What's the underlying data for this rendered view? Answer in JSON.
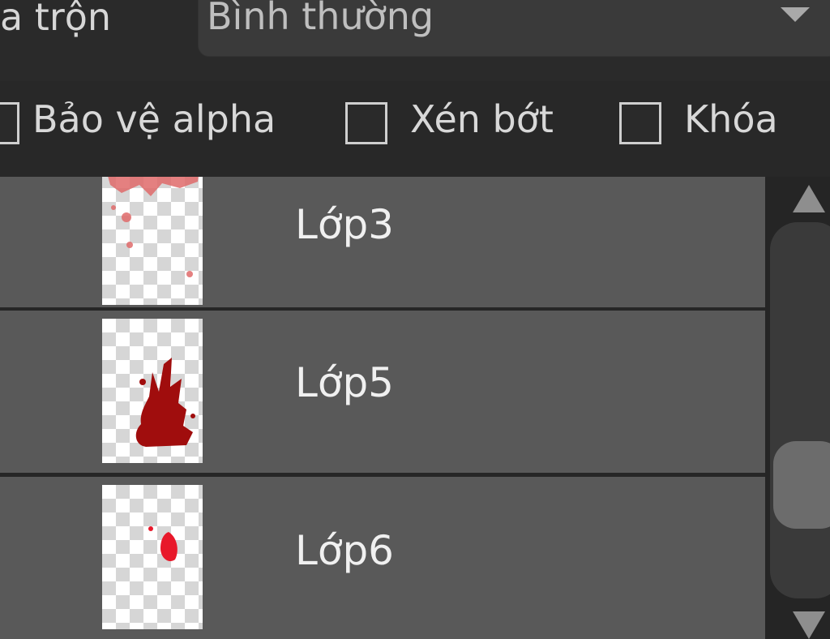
{
  "blend": {
    "label": "a trộn",
    "value": "Bình thường"
  },
  "options": [
    {
      "label": "Bảo vệ alpha",
      "checked": false
    },
    {
      "label": "Xén bớt",
      "checked": false
    },
    {
      "label": "Khóa",
      "checked": false
    }
  ],
  "layers": [
    {
      "name": "Lớp3"
    },
    {
      "name": "Lớp5"
    },
    {
      "name": "Lớp6"
    }
  ],
  "colors": {
    "row": "#595959",
    "blood": "#a00d0d",
    "splash": "#e06a6a"
  }
}
